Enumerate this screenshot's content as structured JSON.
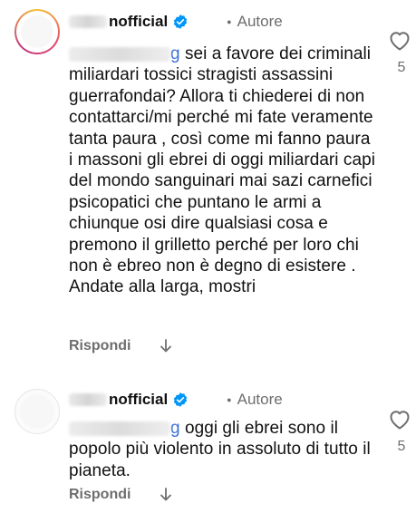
{
  "comments": [
    {
      "username": "nofficial",
      "author_badge": "Autore",
      "mention_suffix": "g",
      "text": "sei a favore dei criminali miliardari tossici stragisti assassini guerrafondai? Allora ti chiederei di non contattarci/mi perché mi fate veramente tanta paura , così come mi fanno paura i massoni gli ebrei di oggi miliardari capi del mondo sanguinari mai sazi carnefici psicopatici che puntano le armi a chiunque osi dire qualsiasi cosa e premono il grilletto perché per loro chi non è ebreo non è degno di esistere . Andate alla larga, mostri",
      "reply_label": "Rispondi",
      "likes": "5"
    },
    {
      "username": "nofficial",
      "author_badge": "Autore",
      "mention_suffix": "g",
      "text": "oggi gli ebrei sono il popolo più violento in assoluto di tutto il pianeta.",
      "reply_label": "Rispondi",
      "likes": "5"
    }
  ],
  "colors": {
    "verified": "#0095f6",
    "mention": "#3b6fd6",
    "secondary_text": "#6e6e6e"
  },
  "icons": [
    "verified-badge-icon",
    "translate-arrow-icon",
    "heart-icon"
  ]
}
